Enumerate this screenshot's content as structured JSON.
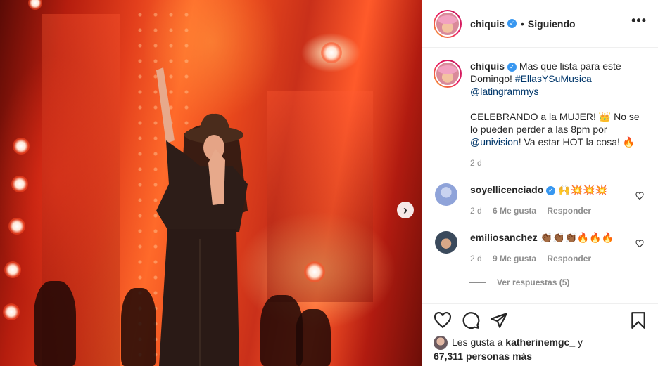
{
  "post": {
    "username": "chiquis",
    "follow_status": "Siguiendo",
    "separator": "•",
    "more_icon": "•••",
    "next_icon": "›",
    "caption": {
      "text1": "Mas que lista para este Domingo! ",
      "hashtag": "#EllasYSuMusica",
      "mention1": "@latingrammys",
      "para2_a": "CELEBRANDO a la MUJER! 👑 No se lo pueden perder a las 8pm por ",
      "mention2": "@univision",
      "para2_b": "! Va estar HOT la cosa! 🔥",
      "time": "2 d"
    },
    "comments": [
      {
        "username": "soyellicenciado",
        "text": "🙌💥💥💥",
        "time": "2 d",
        "likes": "6 Me gusta",
        "reply": "Responder",
        "avatar_color": "#8fa3d9"
      },
      {
        "username": "emiliosanchez",
        "text": "👏🏾👏🏾👏🏾🔥🔥🔥",
        "time": "2 d",
        "likes": "9 Me gusta",
        "reply": "Responder",
        "avatar_color": "#3b4a5c"
      }
    ],
    "view_replies": "Ver respuestas (5)",
    "liked_by": {
      "prefix": "Les gusta a ",
      "user": "katherinemgc_",
      "mid": " y",
      "count": "67,311 personas más"
    },
    "icons": {
      "like": "heart-icon",
      "comment": "comment-icon",
      "share": "share-icon",
      "save": "bookmark-icon",
      "verified": "✓"
    },
    "colors": {
      "link": "#00376b",
      "verified": "#3897f0",
      "muted": "#8e8e8e"
    }
  }
}
